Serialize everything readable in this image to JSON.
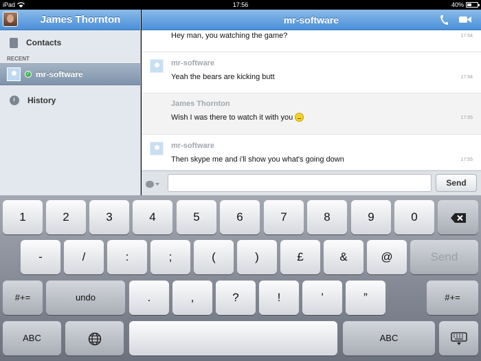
{
  "status_bar": {
    "carrier": "iPad",
    "time": "17:56",
    "battery": "40%",
    "battery_level": 0.4
  },
  "sidebar": {
    "user_name": "James Thornton",
    "contacts_label": "Contacts",
    "recent_label": "RECENT",
    "recent_contact": "mr-software",
    "history_label": "History"
  },
  "chat": {
    "title": "mr-software",
    "messages": [
      {
        "sender": "",
        "text": "Hey man, you watching the game?",
        "time": "17:54",
        "has_avatar": false
      },
      {
        "sender": "mr-software",
        "text": "Yeah the bears are kicking butt",
        "time": "17:54",
        "has_avatar": true
      },
      {
        "sender": "James Thornton",
        "text": "Wish I was there to watch it with you",
        "time": "17:55",
        "has_avatar": false,
        "emoticon": "sad-smiley-icon"
      },
      {
        "sender": "mr-software",
        "text": "Then skype me and i'll show you what's going down",
        "time": "17:55",
        "has_avatar": true
      }
    ],
    "input_value": "",
    "input_placeholder": "",
    "send_label": "Send"
  },
  "keyboard": {
    "row1": [
      "1",
      "2",
      "3",
      "4",
      "5",
      "6",
      "7",
      "8",
      "9",
      "0"
    ],
    "row2": [
      "-",
      "/",
      ":",
      ";",
      "(",
      ")",
      "£",
      "&",
      "@"
    ],
    "row2_send": "Send",
    "row3_left": "#+=",
    "row3_undo": "undo",
    "row3": [
      ".",
      ",",
      "?",
      "!",
      "’",
      "”"
    ],
    "row3_right": "#+=",
    "row4_abc_left": "ABC",
    "row4_abc_right": "ABC"
  }
}
